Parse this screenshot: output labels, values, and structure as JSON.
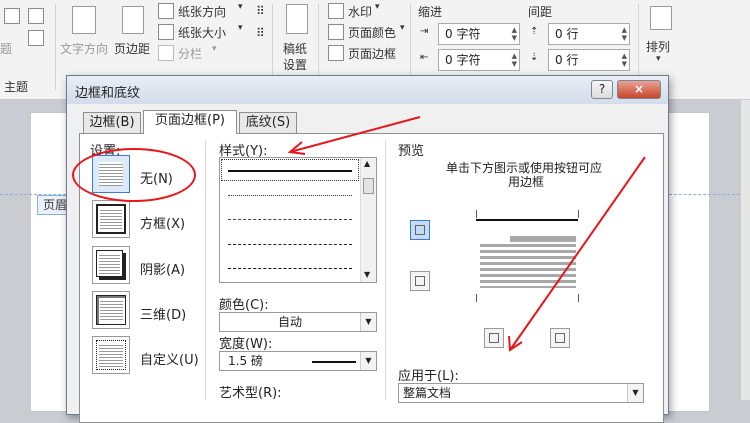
{
  "ribbon": {
    "title_left": "题",
    "theme_label": "主题",
    "text_direction": "文字方向",
    "margins": "页边距",
    "orientation": "纸张方向",
    "size": "纸张大小",
    "columns": "分栏",
    "paper": "稿纸\n设置",
    "paper_line1": "稿纸",
    "paper_line2": "设置",
    "watermark": "水印",
    "page_color": "页面颜色",
    "page_borders": "页面边框",
    "indent_label": "缩进",
    "spacing_label": "间距",
    "indent_left": "0 字符",
    "indent_right": "0 字符",
    "spacing_before": "0 行",
    "spacing_after": "0 行",
    "arrange": "排列"
  },
  "document": {
    "header_tag": "页眉"
  },
  "dialog": {
    "title": "边框和底纹",
    "help": "?",
    "close": "×",
    "tabs": [
      "边框(B)",
      "页面边框(P)",
      "底纹(S)"
    ],
    "settings_label": "设置:",
    "settings": [
      "无(N)",
      "方框(X)",
      "阴影(A)",
      "三维(D)",
      "自定义(U)"
    ],
    "style_label": "样式(Y):",
    "color_label": "颜色(C):",
    "color_value": "自动",
    "width_label": "宽度(W):",
    "width_value": "1.5 磅",
    "art_label": "艺术型(R):",
    "preview_label": "预览",
    "preview_hint_1": "单击下方图示或使用按钮可应",
    "preview_hint_2": "用边框",
    "apply_label": "应用于(L):",
    "apply_value": "整篇文档"
  },
  "annotation_color": "#e8161b"
}
